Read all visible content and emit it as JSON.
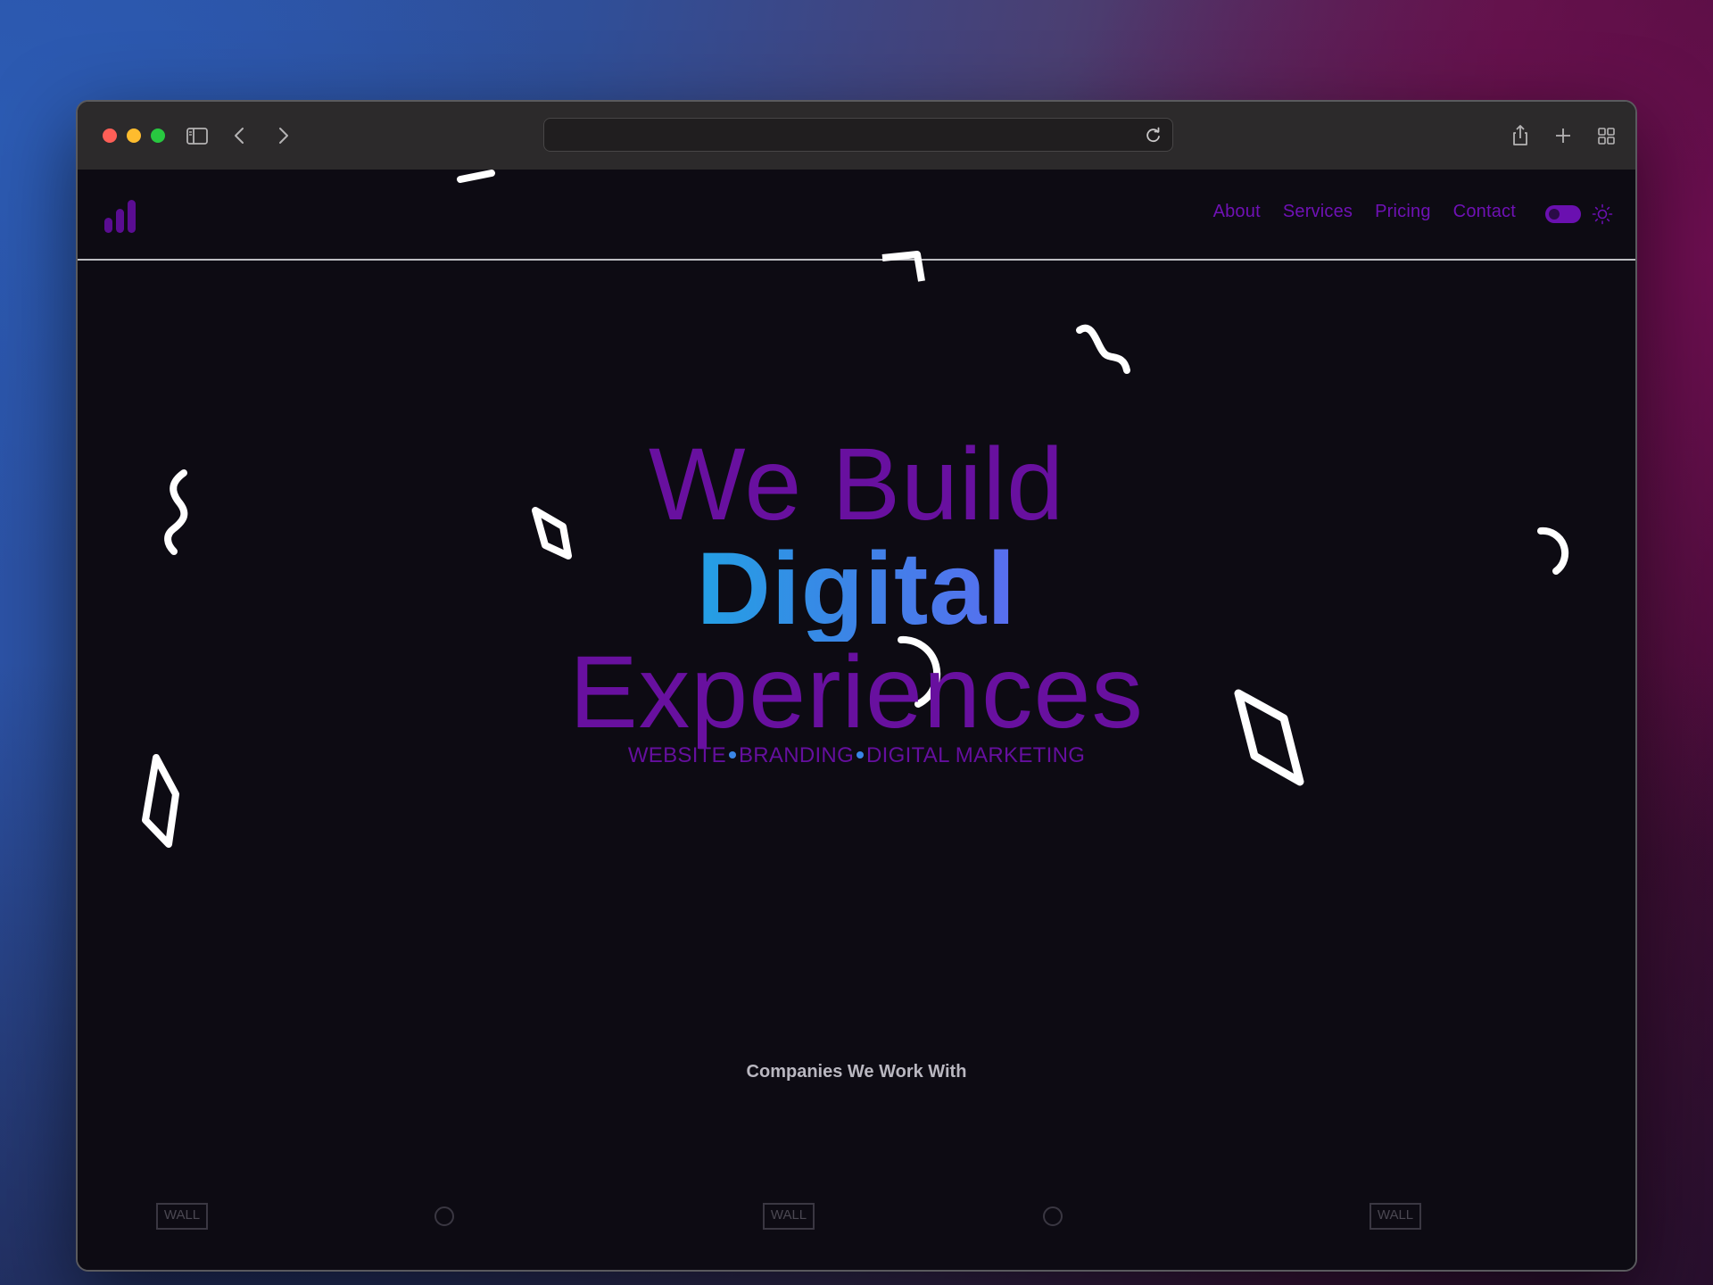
{
  "browser": {
    "url": "",
    "icons": {
      "sidebar": "sidebar-icon",
      "back": "chevron-left-icon",
      "forward": "chevron-right-icon",
      "reload": "reload-icon",
      "share": "share-icon",
      "new_tab": "plus-icon",
      "tab_overview": "grid-icon"
    }
  },
  "header": {
    "logo_icon": "bar-chart-logo-icon",
    "nav": {
      "about": "About",
      "services": "Services",
      "pricing": "Pricing",
      "contact": "Contact"
    },
    "theme_toggle_icon": "sun-icon"
  },
  "hero": {
    "line1": "We Build",
    "line2": "Digital",
    "line3": "Experiences",
    "tagline": {
      "item1": "WEBSITE",
      "item2": "BRANDING",
      "item3": "DIGITAL MARKETING"
    }
  },
  "companies": {
    "title": "Companies We Work With",
    "logo_text": "WALL"
  },
  "colors": {
    "brand_purple": "#68109f",
    "gradient_start": "#22a2e4",
    "gradient_end": "#5b6cf0",
    "page_bg": "#0d0b13"
  }
}
